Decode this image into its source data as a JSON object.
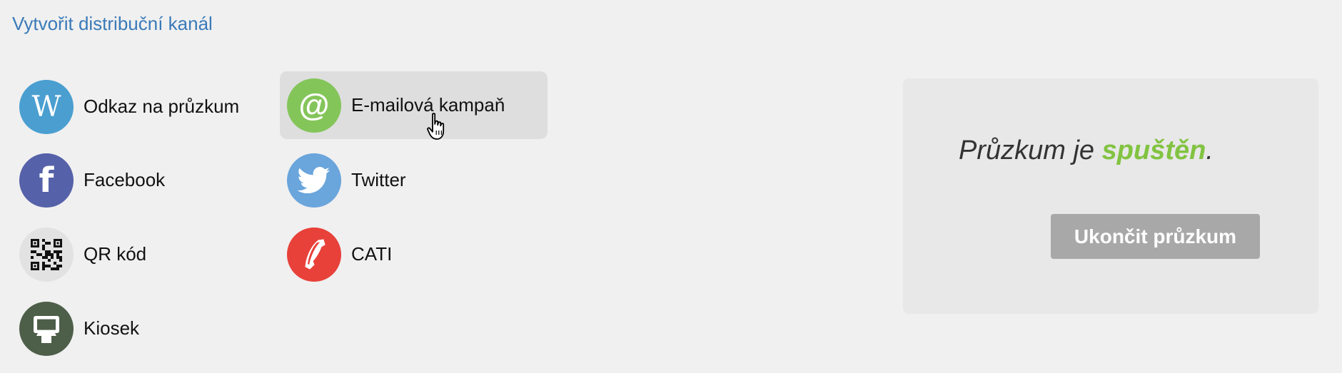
{
  "header": {
    "create_channel_link": "Vytvořit distribuční kanál"
  },
  "channels": [
    {
      "label": "Odkaz na průzkum",
      "icon": "web-link-icon",
      "color": "#4a9fd0",
      "glyph": "W"
    },
    {
      "label": "E-mailová kampaň",
      "icon": "email-at-icon",
      "color": "#84c55a",
      "glyph": "@"
    },
    {
      "label": "Facebook",
      "icon": "facebook-icon",
      "color": "#5561a8",
      "glyph": "f"
    },
    {
      "label": "Twitter",
      "icon": "twitter-bird-icon",
      "color": "#6aa5dc"
    },
    {
      "label": "QR kód",
      "icon": "qr-code-icon",
      "color": "#e2e2e2"
    },
    {
      "label": "CATI",
      "icon": "phone-icon",
      "color": "#e8413a"
    },
    {
      "label": "Kiosek",
      "icon": "kiosk-icon",
      "color": "#4d5e49"
    }
  ],
  "status": {
    "prefix": "Průzkum je ",
    "state": "spuštěn",
    "suffix": ".",
    "state_color": "#82c341",
    "end_button_label": "Ukončit průzkum"
  }
}
